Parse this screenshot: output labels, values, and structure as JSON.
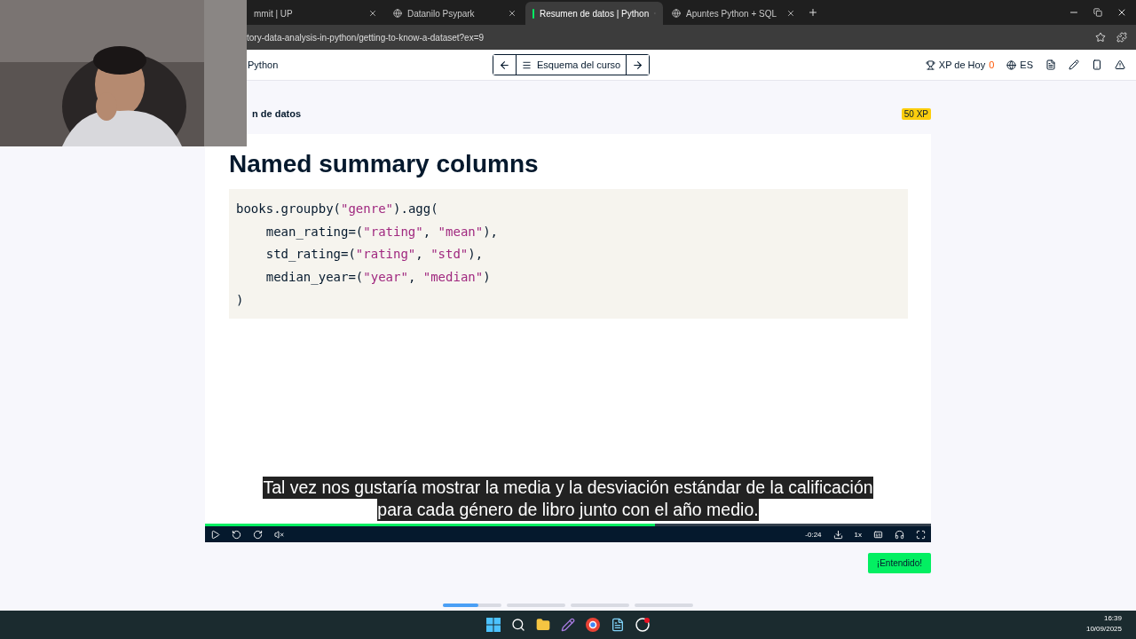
{
  "browser": {
    "tabs": [
      {
        "label": "mmit | UP",
        "selected": false
      },
      {
        "label": "Datanilo Psypark",
        "selected": false
      },
      {
        "label": "Resumen de datos | Python",
        "selected": true
      },
      {
        "label": "Apuntes Python + SQL",
        "selected": false
      }
    ],
    "address": "tory-data-analysis-in-python/getting-to-know-a-dataset?ex=9"
  },
  "header": {
    "course": "Python",
    "outline_button": "Esquema del curso",
    "xp_label": "XP de Hoy",
    "xp_value": "0",
    "language": "ES"
  },
  "exercise": {
    "title": "n de datos",
    "xp_badge": "50 XP"
  },
  "video": {
    "slide_title": "Named summary columns",
    "code": [
      [
        {
          "text": "books.groupby(",
          "kind": "code"
        },
        {
          "text": "\"genre\"",
          "kind": "string"
        },
        {
          "text": ").agg(",
          "kind": "code"
        }
      ],
      [
        {
          "text": "    mean_rating=(",
          "kind": "code"
        },
        {
          "text": "\"rating\"",
          "kind": "string"
        },
        {
          "text": ", ",
          "kind": "code"
        },
        {
          "text": "\"mean\"",
          "kind": "string"
        },
        {
          "text": "),",
          "kind": "code"
        }
      ],
      [
        {
          "text": "    std_rating=(",
          "kind": "code"
        },
        {
          "text": "\"rating\"",
          "kind": "string"
        },
        {
          "text": ", ",
          "kind": "code"
        },
        {
          "text": "\"std\"",
          "kind": "string"
        },
        {
          "text": "),",
          "kind": "code"
        }
      ],
      [
        {
          "text": "    median_year=(",
          "kind": "code"
        },
        {
          "text": "\"year\"",
          "kind": "string"
        },
        {
          "text": ", ",
          "kind": "code"
        },
        {
          "text": "\"median\"",
          "kind": "string"
        },
        {
          "text": ")",
          "kind": "code"
        }
      ],
      [
        {
          "text": ")",
          "kind": "code"
        }
      ]
    ],
    "subtitles": [
      "Tal vez nos gustaría mostrar la media y la desviación estándar de la calificación",
      "para cada género de libro junto con el año medio."
    ],
    "progress": {
      "level": 0.62
    },
    "time_left": "-0:24",
    "speed": "1x"
  },
  "confirm_button": "¡Entendido!",
  "steps": [
    {
      "level": 0.6
    },
    {
      "level": 0
    },
    {
      "level": 0
    },
    {
      "level": 0
    }
  ],
  "taskbar": {
    "time": "16:39",
    "date": "10/09/2025"
  }
}
